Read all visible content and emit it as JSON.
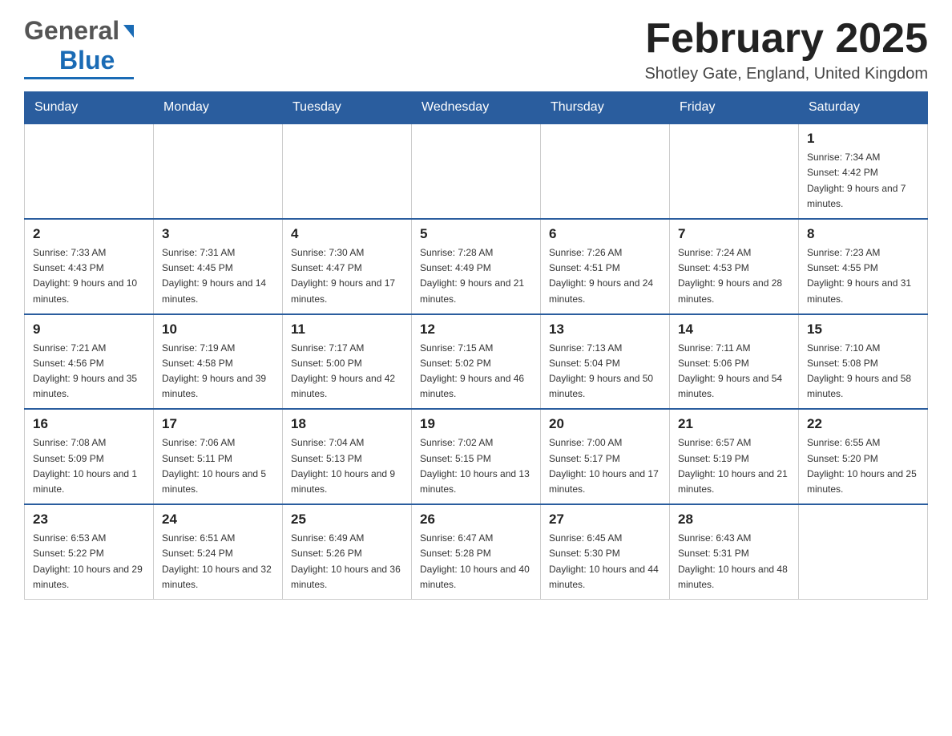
{
  "header": {
    "logo_general": "General",
    "logo_blue": "Blue",
    "month_title": "February 2025",
    "location": "Shotley Gate, England, United Kingdom"
  },
  "days_of_week": [
    "Sunday",
    "Monday",
    "Tuesday",
    "Wednesday",
    "Thursday",
    "Friday",
    "Saturday"
  ],
  "weeks": [
    [
      {
        "num": "",
        "info": ""
      },
      {
        "num": "",
        "info": ""
      },
      {
        "num": "",
        "info": ""
      },
      {
        "num": "",
        "info": ""
      },
      {
        "num": "",
        "info": ""
      },
      {
        "num": "",
        "info": ""
      },
      {
        "num": "1",
        "info": "Sunrise: 7:34 AM\nSunset: 4:42 PM\nDaylight: 9 hours and 7 minutes."
      }
    ],
    [
      {
        "num": "2",
        "info": "Sunrise: 7:33 AM\nSunset: 4:43 PM\nDaylight: 9 hours and 10 minutes."
      },
      {
        "num": "3",
        "info": "Sunrise: 7:31 AM\nSunset: 4:45 PM\nDaylight: 9 hours and 14 minutes."
      },
      {
        "num": "4",
        "info": "Sunrise: 7:30 AM\nSunset: 4:47 PM\nDaylight: 9 hours and 17 minutes."
      },
      {
        "num": "5",
        "info": "Sunrise: 7:28 AM\nSunset: 4:49 PM\nDaylight: 9 hours and 21 minutes."
      },
      {
        "num": "6",
        "info": "Sunrise: 7:26 AM\nSunset: 4:51 PM\nDaylight: 9 hours and 24 minutes."
      },
      {
        "num": "7",
        "info": "Sunrise: 7:24 AM\nSunset: 4:53 PM\nDaylight: 9 hours and 28 minutes."
      },
      {
        "num": "8",
        "info": "Sunrise: 7:23 AM\nSunset: 4:55 PM\nDaylight: 9 hours and 31 minutes."
      }
    ],
    [
      {
        "num": "9",
        "info": "Sunrise: 7:21 AM\nSunset: 4:56 PM\nDaylight: 9 hours and 35 minutes."
      },
      {
        "num": "10",
        "info": "Sunrise: 7:19 AM\nSunset: 4:58 PM\nDaylight: 9 hours and 39 minutes."
      },
      {
        "num": "11",
        "info": "Sunrise: 7:17 AM\nSunset: 5:00 PM\nDaylight: 9 hours and 42 minutes."
      },
      {
        "num": "12",
        "info": "Sunrise: 7:15 AM\nSunset: 5:02 PM\nDaylight: 9 hours and 46 minutes."
      },
      {
        "num": "13",
        "info": "Sunrise: 7:13 AM\nSunset: 5:04 PM\nDaylight: 9 hours and 50 minutes."
      },
      {
        "num": "14",
        "info": "Sunrise: 7:11 AM\nSunset: 5:06 PM\nDaylight: 9 hours and 54 minutes."
      },
      {
        "num": "15",
        "info": "Sunrise: 7:10 AM\nSunset: 5:08 PM\nDaylight: 9 hours and 58 minutes."
      }
    ],
    [
      {
        "num": "16",
        "info": "Sunrise: 7:08 AM\nSunset: 5:09 PM\nDaylight: 10 hours and 1 minute."
      },
      {
        "num": "17",
        "info": "Sunrise: 7:06 AM\nSunset: 5:11 PM\nDaylight: 10 hours and 5 minutes."
      },
      {
        "num": "18",
        "info": "Sunrise: 7:04 AM\nSunset: 5:13 PM\nDaylight: 10 hours and 9 minutes."
      },
      {
        "num": "19",
        "info": "Sunrise: 7:02 AM\nSunset: 5:15 PM\nDaylight: 10 hours and 13 minutes."
      },
      {
        "num": "20",
        "info": "Sunrise: 7:00 AM\nSunset: 5:17 PM\nDaylight: 10 hours and 17 minutes."
      },
      {
        "num": "21",
        "info": "Sunrise: 6:57 AM\nSunset: 5:19 PM\nDaylight: 10 hours and 21 minutes."
      },
      {
        "num": "22",
        "info": "Sunrise: 6:55 AM\nSunset: 5:20 PM\nDaylight: 10 hours and 25 minutes."
      }
    ],
    [
      {
        "num": "23",
        "info": "Sunrise: 6:53 AM\nSunset: 5:22 PM\nDaylight: 10 hours and 29 minutes."
      },
      {
        "num": "24",
        "info": "Sunrise: 6:51 AM\nSunset: 5:24 PM\nDaylight: 10 hours and 32 minutes."
      },
      {
        "num": "25",
        "info": "Sunrise: 6:49 AM\nSunset: 5:26 PM\nDaylight: 10 hours and 36 minutes."
      },
      {
        "num": "26",
        "info": "Sunrise: 6:47 AM\nSunset: 5:28 PM\nDaylight: 10 hours and 40 minutes."
      },
      {
        "num": "27",
        "info": "Sunrise: 6:45 AM\nSunset: 5:30 PM\nDaylight: 10 hours and 44 minutes."
      },
      {
        "num": "28",
        "info": "Sunrise: 6:43 AM\nSunset: 5:31 PM\nDaylight: 10 hours and 48 minutes."
      },
      {
        "num": "",
        "info": ""
      }
    ]
  ]
}
